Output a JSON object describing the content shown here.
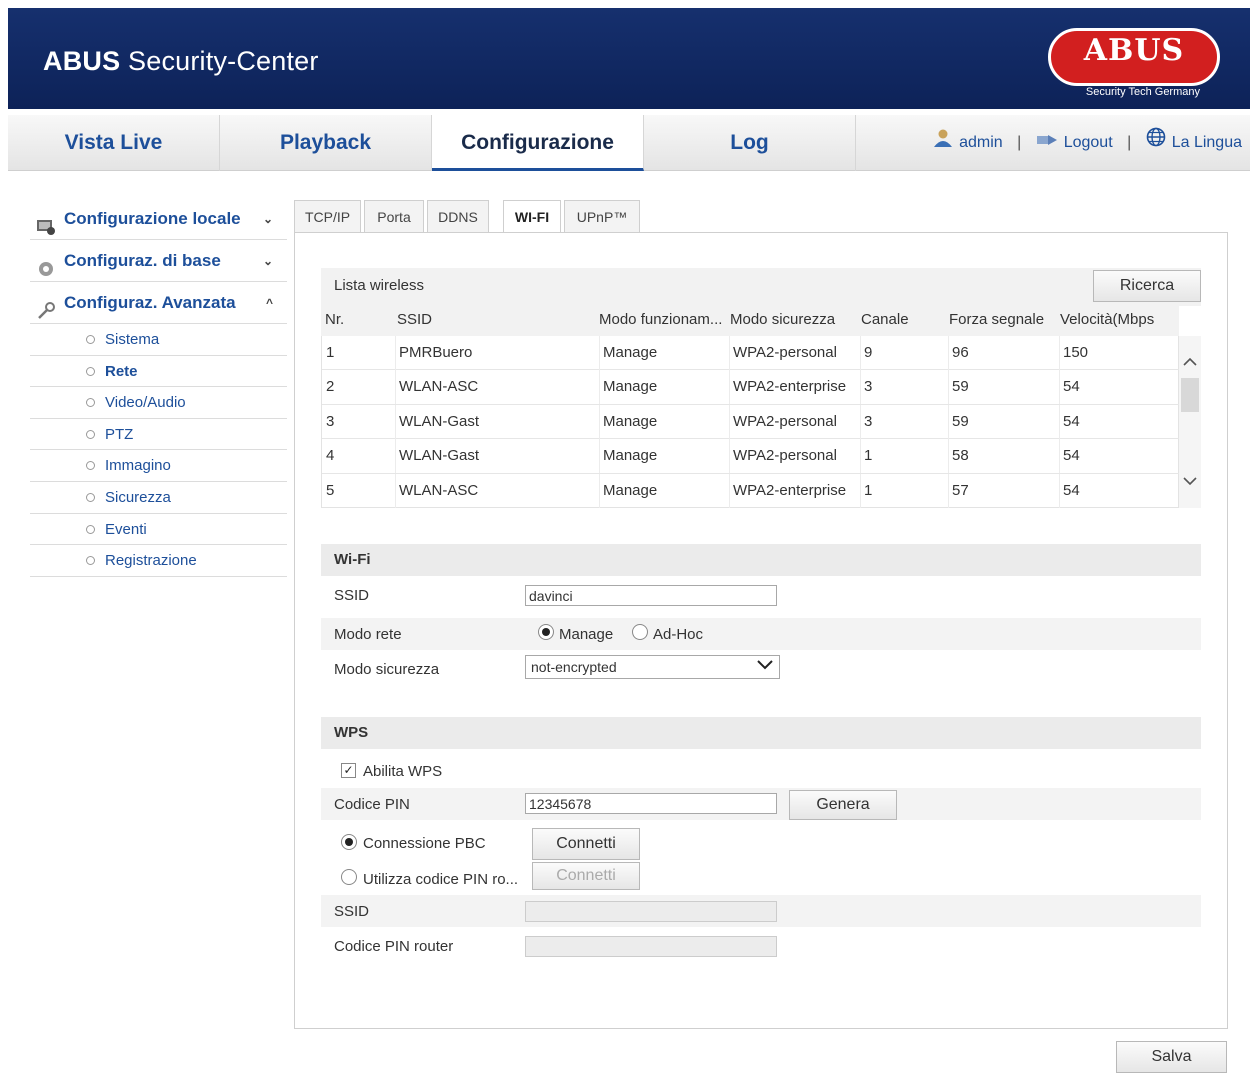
{
  "header": {
    "title_bold": "ABUS",
    "title_rest": " Security-Center",
    "logo_text": "ABUS",
    "logo_tagline": "Security Tech Germany"
  },
  "nav": {
    "tabs": [
      {
        "label": "Vista Live"
      },
      {
        "label": "Playback"
      },
      {
        "label": "Configurazione"
      },
      {
        "label": "Log"
      }
    ],
    "user": "admin",
    "logout": "Logout",
    "language": "La Lingua",
    "separator": "|"
  },
  "sidebar": {
    "sections": [
      {
        "label": "Configurazione locale",
        "chevron": "⌄"
      },
      {
        "label": "Configuraz. di base",
        "chevron": "⌄"
      },
      {
        "label": "Configuraz. Avanzata",
        "chevron": "^"
      }
    ],
    "items": [
      {
        "label": "Sistema"
      },
      {
        "label": "Rete"
      },
      {
        "label": "Video/Audio"
      },
      {
        "label": "PTZ"
      },
      {
        "label": "Immagino"
      },
      {
        "label": "Sicurezza"
      },
      {
        "label": "Eventi"
      },
      {
        "label": "Registrazione"
      }
    ]
  },
  "subtabs": [
    "TCP/IP",
    "Porta",
    "DDNS",
    "WI-FI",
    "UPnP™"
  ],
  "wireless_list": {
    "title": "Lista wireless",
    "search_button": "Ricerca",
    "columns": [
      "Nr.",
      "SSID",
      "Modo funzionam...",
      "Modo sicurezza",
      "Canale",
      "Forza segnale",
      "Velocità(Mbps"
    ],
    "rows": [
      [
        "1",
        "PMRBuero",
        "Manage",
        "WPA2-personal",
        "9",
        "96",
        "150"
      ],
      [
        "2",
        "WLAN-ASC",
        "Manage",
        "WPA2-enterprise",
        "3",
        "59",
        "54"
      ],
      [
        "3",
        "WLAN-Gast",
        "Manage",
        "WPA2-personal",
        "3",
        "59",
        "54"
      ],
      [
        "4",
        "WLAN-Gast",
        "Manage",
        "WPA2-personal",
        "1",
        "58",
        "54"
      ],
      [
        "5",
        "WLAN-ASC",
        "Manage",
        "WPA2-enterprise",
        "1",
        "57",
        "54"
      ]
    ]
  },
  "wifi": {
    "section_title": "Wi-Fi",
    "ssid_label": "SSID",
    "ssid_value": "davinci",
    "mode_label": "Modo rete",
    "mode_manage": "Manage",
    "mode_adhoc": "Ad-Hoc",
    "security_label": "Modo sicurezza",
    "security_value": "not-encrypted"
  },
  "wps": {
    "section_title": "WPS",
    "enable_label": "Abilita WPS",
    "pin_label": "Codice PIN",
    "pin_value": "12345678",
    "generate_button": "Genera",
    "pbc_label": "Connessione PBC",
    "connect_button": "Connetti",
    "router_pin_option": "Utilizza codice PIN ro...",
    "connect_button_2": "Connetti",
    "ssid_label": "SSID",
    "router_pin_label": "Codice PIN router"
  },
  "save_button": "Salva"
}
